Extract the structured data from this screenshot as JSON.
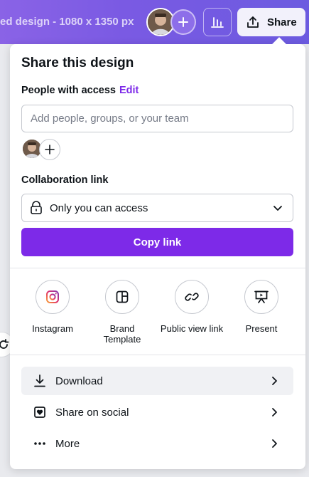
{
  "topbar": {
    "doc_title": "ed design - 1080 x 1350 px",
    "share_label": "Share",
    "colors": {
      "bar": "#7a5ae3",
      "share_bg": "#f2f1fb"
    }
  },
  "panel": {
    "title": "Share this design",
    "people_label": "People with access",
    "edit_label": "Edit",
    "people_placeholder": "Add people, groups, or your team",
    "collab_label": "Collaboration link",
    "access_value": "Only you can access",
    "copy_label": "Copy link",
    "accent": "#7d2ae8"
  },
  "share_options": [
    {
      "label": "Instagram",
      "icon": "instagram-icon"
    },
    {
      "label": "Brand Template",
      "icon": "template-icon"
    },
    {
      "label": "Public view link",
      "icon": "link-icon"
    },
    {
      "label": "Present",
      "icon": "present-icon"
    }
  ],
  "actions": [
    {
      "label": "Download",
      "icon": "download-icon"
    },
    {
      "label": "Share on social",
      "icon": "heart-icon"
    },
    {
      "label": "More",
      "icon": "more-icon"
    }
  ]
}
